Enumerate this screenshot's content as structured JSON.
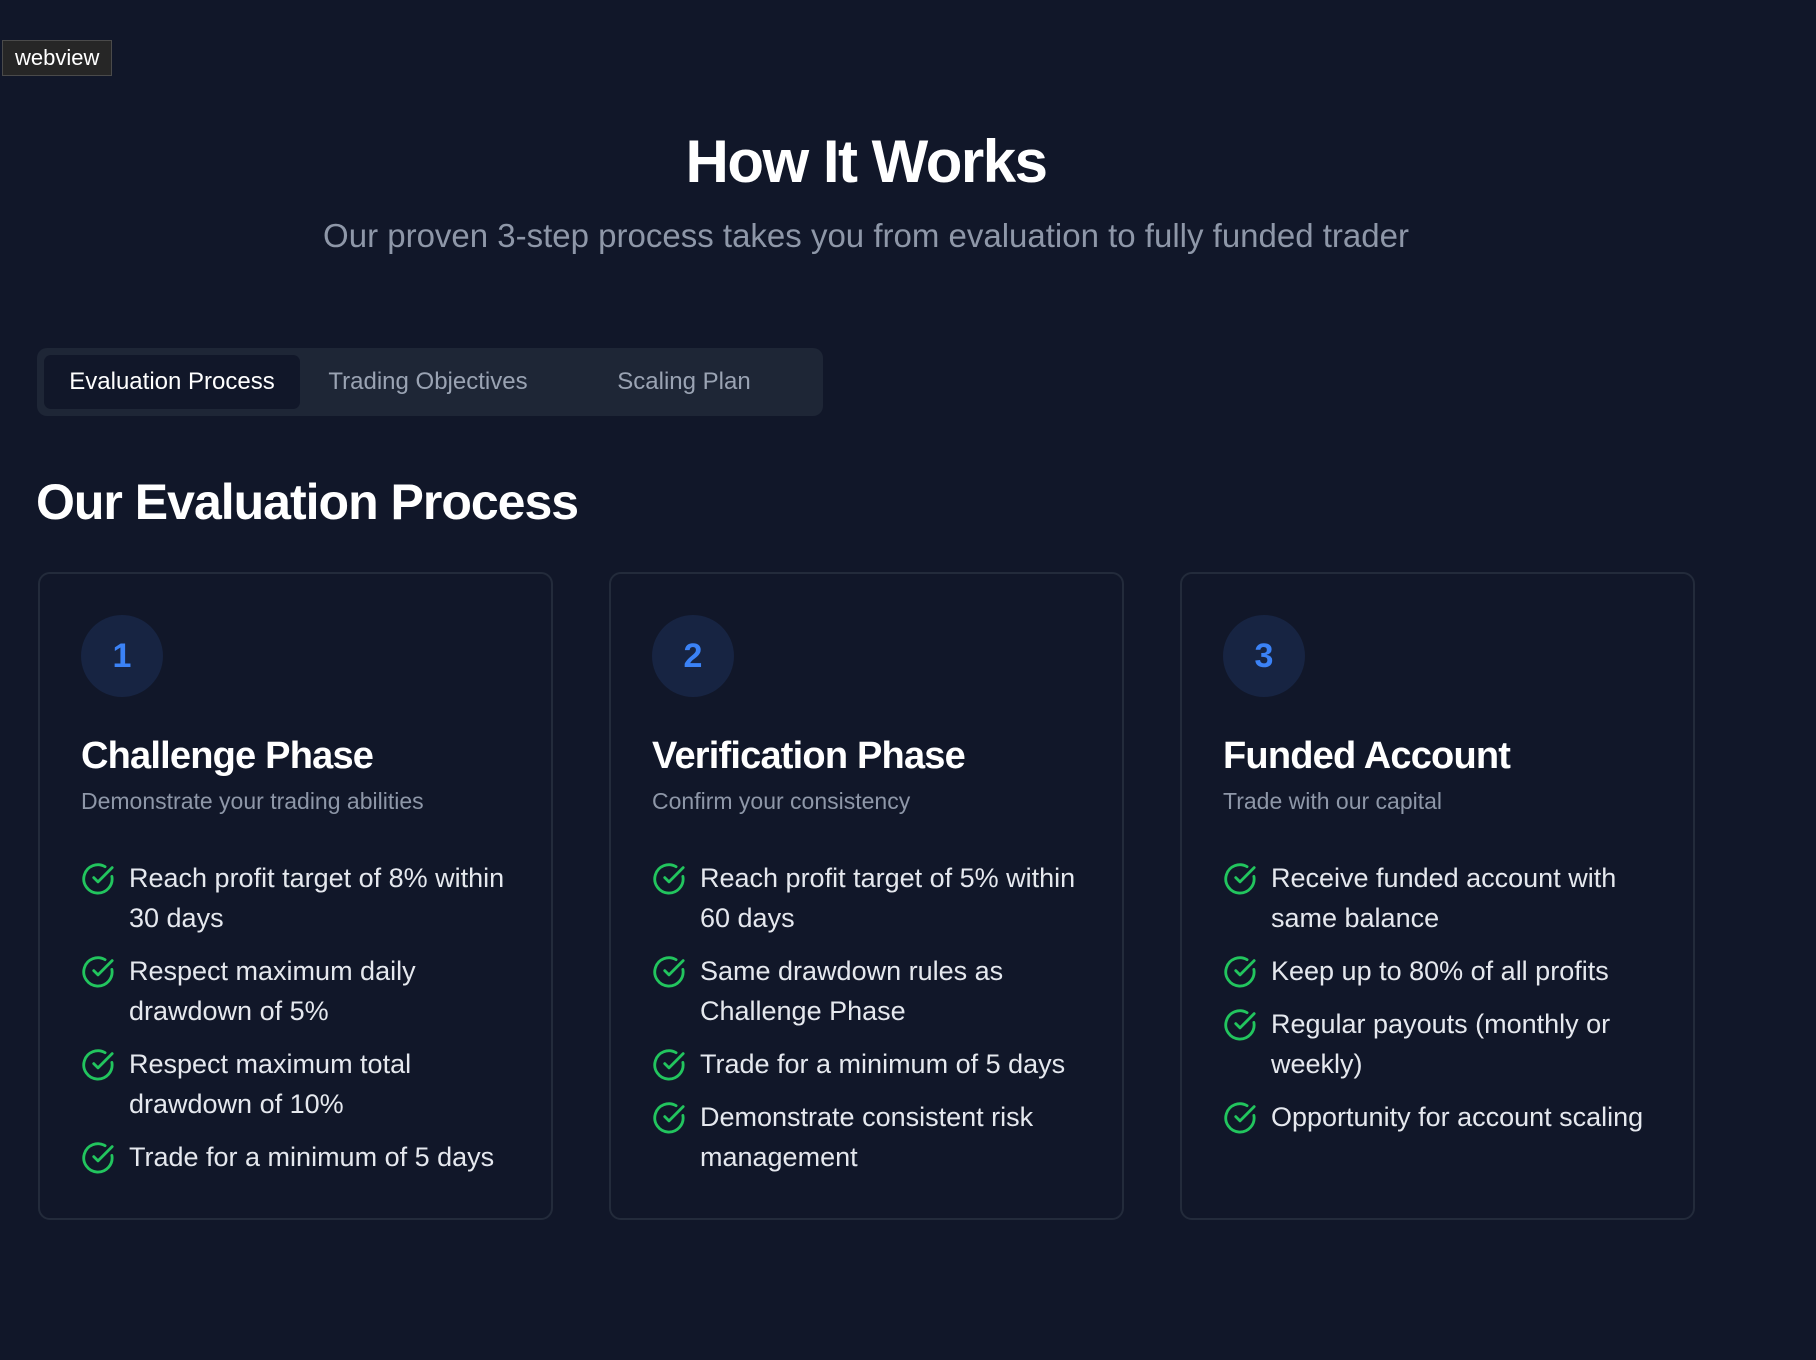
{
  "webview_label": "webview",
  "header": {
    "title": "How It Works",
    "subtitle": "Our proven 3-step process takes you from evaluation to fully funded trader"
  },
  "tabs": [
    {
      "label": "Evaluation Process",
      "active": true
    },
    {
      "label": "Trading Objectives",
      "active": false
    },
    {
      "label": "Scaling Plan",
      "active": false
    }
  ],
  "section_title": "Our Evaluation Process",
  "colors": {
    "background": "#111729",
    "accent": "#3b82f6",
    "check": "#22c55e",
    "muted_text": "#8e97a8"
  },
  "cards": [
    {
      "step": "1",
      "title": "Challenge Phase",
      "subtitle": "Demonstrate your trading abilities",
      "features": [
        "Reach profit target of 8% within 30 days",
        "Respect maximum daily drawdown of 5%",
        "Respect maximum total drawdown of 10%",
        "Trade for a minimum of 5 days"
      ]
    },
    {
      "step": "2",
      "title": "Verification Phase",
      "subtitle": "Confirm your consistency",
      "features": [
        "Reach profit target of 5% within 60 days",
        "Same drawdown rules as Challenge Phase",
        "Trade for a minimum of 5 days",
        "Demonstrate consistent risk management"
      ]
    },
    {
      "step": "3",
      "title": "Funded Account",
      "subtitle": "Trade with our capital",
      "features": [
        "Receive funded account with same balance",
        "Keep up to 80% of all profits",
        "Regular payouts (monthly or weekly)",
        "Opportunity for account scaling"
      ]
    }
  ]
}
